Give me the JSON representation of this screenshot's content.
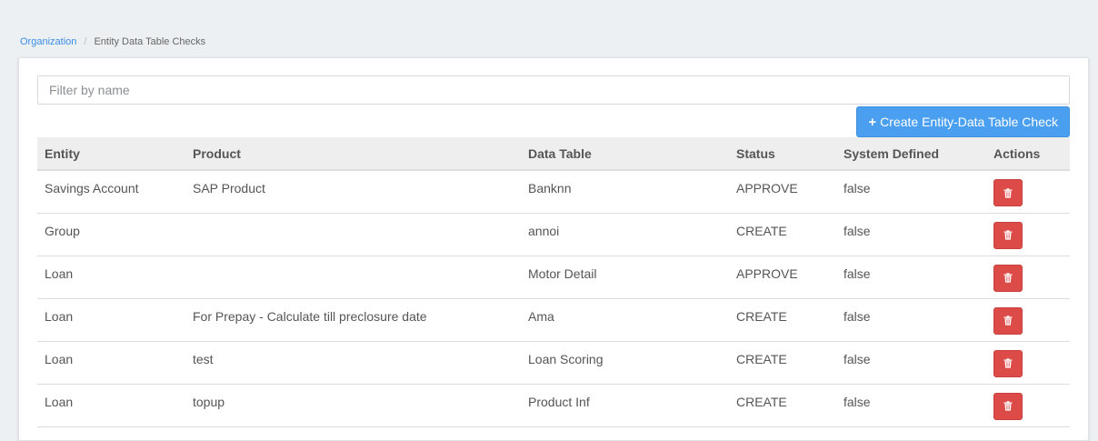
{
  "breadcrumb": {
    "parent": "Organization",
    "separator": "/",
    "current": "Entity Data Table Checks"
  },
  "filter": {
    "placeholder": "Filter by name",
    "value": ""
  },
  "create_button": {
    "icon": "plus-icon",
    "label": "Create Entity-Data Table Check"
  },
  "table": {
    "headers": {
      "entity": "Entity",
      "product": "Product",
      "data_table": "Data Table",
      "status": "Status",
      "system_defined": "System Defined",
      "actions": "Actions"
    },
    "rows": [
      {
        "entity": "Savings Account",
        "product": "SAP Product",
        "data_table": "Banknn",
        "status": "APPROVE",
        "system_defined": "false"
      },
      {
        "entity": "Group",
        "product": "",
        "data_table": "annoi",
        "status": "CREATE",
        "system_defined": "false"
      },
      {
        "entity": "Loan",
        "product": "",
        "data_table": "Motor Detail",
        "status": "APPROVE",
        "system_defined": "false"
      },
      {
        "entity": "Loan",
        "product": "For Prepay - Calculate till preclosure date",
        "data_table": "Ama",
        "status": "CREATE",
        "system_defined": "false"
      },
      {
        "entity": "Loan",
        "product": "test",
        "data_table": "Loan Scoring",
        "status": "CREATE",
        "system_defined": "false"
      },
      {
        "entity": "Loan",
        "product": "topup",
        "data_table": "Product Inf",
        "status": "CREATE",
        "system_defined": "false"
      }
    ],
    "delete_icon": "trash-icon"
  },
  "colors": {
    "primary": "#4a9ff0",
    "danger": "#dd4b48",
    "link": "#3a8ee6",
    "background": "#edf0f3"
  }
}
